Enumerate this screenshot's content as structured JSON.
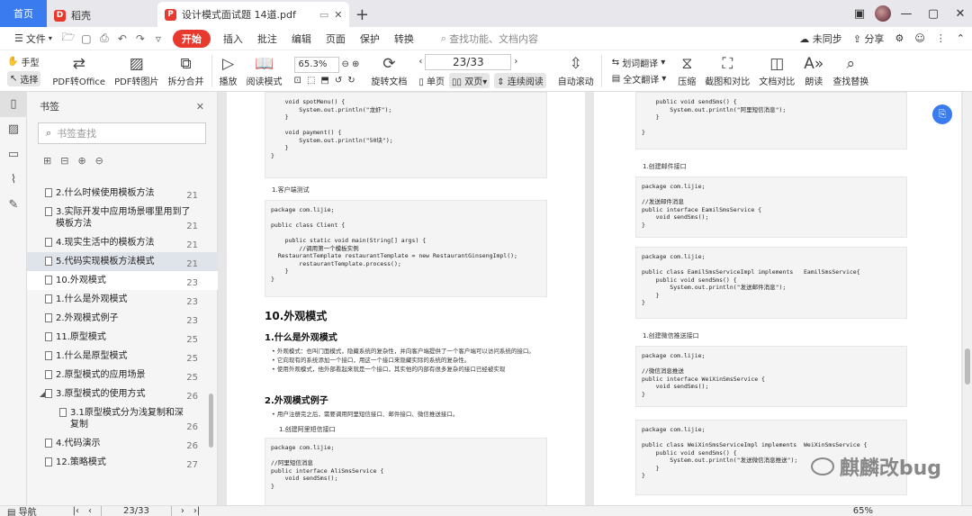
{
  "titlebar": {
    "home_tab": "首页",
    "tabs": [
      {
        "label": "稻壳",
        "logo": "D"
      },
      {
        "label": "设计模式面试题 14道.pdf",
        "logo": "P"
      }
    ],
    "new_tab": "+"
  },
  "menubar": {
    "file": "文件",
    "start": "开始",
    "items": [
      "插入",
      "批注",
      "编辑",
      "页面",
      "保护",
      "转换"
    ],
    "search_placeholder": "查找功能、文档内容",
    "sync": "未同步",
    "share": "分享"
  },
  "toolbar": {
    "hand": "手型",
    "select": "选择",
    "pdf_to_office": "PDF转Office",
    "pdf_to_image": "PDF转图片",
    "split_merge": "拆分合并",
    "play": "播放",
    "read_mode": "阅读模式",
    "zoom": "65.3%",
    "rotate": "旋转文档",
    "page_value": "23/33",
    "single": "单页",
    "double": "双页",
    "continuous": "连续阅读",
    "auto_scroll": "自动滚动",
    "translate": "划词翻译",
    "full_translate": "全文翻译",
    "compress": "压缩",
    "screenshot": "截图和对比",
    "compare": "文档对比",
    "read_aloud": "朗读",
    "find_replace": "查找替换"
  },
  "sidebar": {
    "title": "书签",
    "search_placeholder": "书签查找",
    "items": [
      {
        "label": "2.什么时候使用模板方法",
        "page": "21",
        "level": 1
      },
      {
        "label": "3.实际开发中应用场景哪里用到了模板方法",
        "page": "21",
        "level": 1
      },
      {
        "label": "4.现实生活中的模板方法",
        "page": "21",
        "level": 1
      },
      {
        "label": "5.代码实现模板方法模式",
        "page": "21",
        "level": 1,
        "state": "selected"
      },
      {
        "label": "10.外观模式",
        "page": "23",
        "level": 1,
        "state": "current"
      },
      {
        "label": "1.什么是外观模式",
        "page": "23",
        "level": 1
      },
      {
        "label": "2.外观模式例子",
        "page": "23",
        "level": 1
      },
      {
        "label": "11.原型模式",
        "page": "25",
        "level": 1
      },
      {
        "label": "1.什么是原型模式",
        "page": "25",
        "level": 1
      },
      {
        "label": "2.原型模式的应用场景",
        "page": "25",
        "level": 1
      },
      {
        "label": "3.原型模式的使用方式",
        "page": "26",
        "level": 1,
        "expanded": true
      },
      {
        "label": "3.1原型模式分为浅复制和深复制",
        "page": "26",
        "level": 2
      },
      {
        "label": "4.代码演示",
        "page": "26",
        "level": 1
      },
      {
        "label": "12.策略模式",
        "page": "27",
        "level": 1
      }
    ]
  },
  "left_page": {
    "code1": "    void spotMenu() {\n        System.out.println(\"龙虾\");\n    }\n\n    void payment() {\n        System.out.println(\"50块\");\n    }\n}",
    "caption1": "1.客户端测试",
    "code2": "package com.lijie;\n\npublic class Client {\n\n    public static void main(String[] args) {\n        //调用第一个模板实例\n  RestaurantTemplate restaurantTemplate = new RestaurantGinsengImpl();\n        restaurantTemplate.process();\n    }\n}",
    "h2": "10.外观模式",
    "h3a": "1.什么是外观模式",
    "bullets": [
      "外观模式：也叫门面模式，隐藏系统的复杂性，并向客户端提供了一个客户端可以访问系统的接口。",
      "它向现有的系统添加一个接口，用这一个接口来隐藏实际的系统的复杂性。",
      "使用外观模式，他外部看起来就是一个接口，其实他的内部有很多复杂的接口已经被实现"
    ],
    "h3b": "2.外观模式例子",
    "bullet2": "用户注册完之后，需要调用阿里短信接口、邮件接口、微信推送接口。",
    "caption2": "1.创建阿里短信接口",
    "code3": "package com.lijie;\n\n//阿里短信消息\npublic interface AliSmsService {\n    void sendSms();\n}"
  },
  "right_page": {
    "code1": "    public void sendSms() {\n        System.out.println(\"阿里短信消息\");\n    }\n\n}",
    "caption1": "1.创建邮件接口",
    "code2": "package com.lijie;\n\n//发送邮件消息\npublic interface EamilSmsService {\n    void sendSms();\n}",
    "code3": "package com.lijie;\n\npublic class EamilSmsServiceImpl implements   EamilSmsService{\n    public void sendSms() {\n        System.out.println(\"发送邮件消息\");\n    }\n}",
    "caption2": "1.创建微信推送接口",
    "code4": "package com.lijie;\n\n//微信消息推送\npublic interface WeiXinSmsService {\n    void sendSms();\n}",
    "code5": "package com.lijie;\n\npublic class WeiXinSmsServiceImpl implements  WeiXinSmsService {\n    public void sendSms() {\n        System.out.println(\"发送微信消息推送\");\n    }\n}"
  },
  "watermark": "麒麟改bug",
  "status": {
    "outline": "导航",
    "page": "23/33",
    "zoom": "65%"
  }
}
